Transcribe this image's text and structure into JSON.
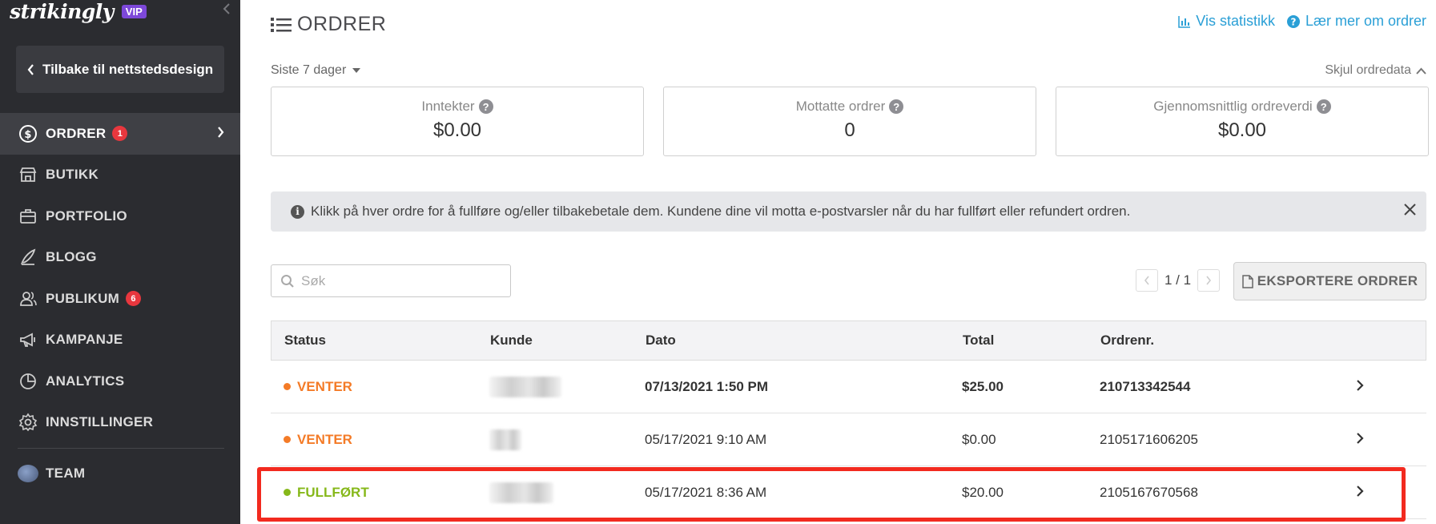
{
  "sidebar": {
    "logo": "strikingly",
    "vip_badge": "VIP",
    "back_label": "Tilbake til nettstedsdesign",
    "items": [
      {
        "label": "ORDRER",
        "icon": "dollar-circle-icon",
        "badge": "1",
        "active": true
      },
      {
        "label": "BUTIKK",
        "icon": "store-icon"
      },
      {
        "label": "PORTFOLIO",
        "icon": "briefcase-icon"
      },
      {
        "label": "BLOGG",
        "icon": "quill-icon"
      },
      {
        "label": "PUBLIKUM",
        "icon": "people-icon",
        "badge": "6"
      },
      {
        "label": "KAMPANJE",
        "icon": "megaphone-icon"
      },
      {
        "label": "ANALYTICS",
        "icon": "pie-chart-icon"
      },
      {
        "label": "INNSTILLINGER",
        "icon": "gear-icon"
      }
    ],
    "team_label": "TEAM"
  },
  "header": {
    "title": "ORDRER",
    "stats_link": "Vis statistikk",
    "learn_link": "Lær mer om ordrer"
  },
  "filters": {
    "range": "Siste 7 dager",
    "hide_data": "Skjul ordredata"
  },
  "stats": [
    {
      "label": "Inntekter",
      "value": "$0.00"
    },
    {
      "label": "Mottatte ordrer",
      "value": "0"
    },
    {
      "label": "Gjennomsnittlig ordreverdi",
      "value": "$0.00"
    }
  ],
  "notice": "Klikk på hver ordre for å fullføre og/eller tilbakebetale dem. Kundene dine vil motta e-postvarsler når du har fullført eller refundert ordren.",
  "search": {
    "placeholder": "Søk"
  },
  "pager": {
    "text": "1 / 1"
  },
  "export_label": "EKSPORTERE ORDRER",
  "table": {
    "columns": [
      "Status",
      "Kunde",
      "Dato",
      "Total",
      "Ordrenr."
    ],
    "rows": [
      {
        "status": "VENTER",
        "status_color": "#f47b27",
        "date": "07/13/2021 1:50 PM",
        "total": "$25.00",
        "order": "210713342544",
        "bold": true
      },
      {
        "status": "VENTER",
        "status_color": "#f47b27",
        "date": "05/17/2021 9:10 AM",
        "total": "$0.00",
        "order": "2105171606205",
        "bold": false
      },
      {
        "status": "FULLFØRT",
        "status_color": "#86b81a",
        "date": "05/17/2021 8:36 AM",
        "total": "$20.00",
        "order": "2105167670568",
        "bold": false
      }
    ]
  },
  "colors": {
    "sidebar_bg": "#2b2c30",
    "link": "#2a9fd6",
    "pending": "#f47b27",
    "done": "#86b81a",
    "highlight": "#f22a1f"
  }
}
